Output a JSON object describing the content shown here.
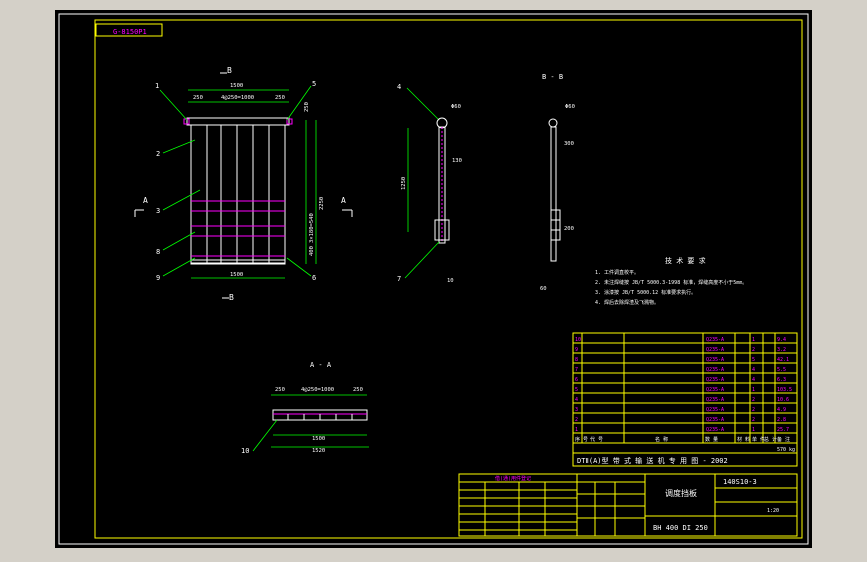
{
  "drawing_code": "G-8150P1",
  "views": {
    "front_title": "B",
    "side_title": "B - B",
    "plan_title": "A - A",
    "section_marker_a": "A",
    "section_marker_b": "B"
  },
  "dimensions": {
    "top_left": "250",
    "top_mid": "4@250=1000",
    "top_right": "250",
    "overall_top": "1500",
    "bottom_width": "1500",
    "right_top": "250",
    "right_mid": "3×180=540",
    "right_total": "2250",
    "right_low": "400",
    "side_height": "1250",
    "side_phi_1": "Φ60",
    "side_phi_2": "Φ60",
    "side_dim_130": "130",
    "side_dim_10": "10",
    "bb_dim_300": "300",
    "bb_dim_60": "60",
    "bb_dim_200": "200",
    "plan_left": "250",
    "plan_mid": "4@250=1000",
    "plan_right": "250",
    "plan_total_1": "1500",
    "plan_total_2": "1520"
  },
  "callouts": [
    "1",
    "2",
    "3",
    "8",
    "9",
    "5",
    "6",
    "4",
    "7",
    "10"
  ],
  "notes": {
    "title": "技 术 要 求",
    "lines": [
      "1. 工件调直校平。",
      "2. 未注焊缝按 JB/T 5000.3-1998 标准，焊缝高度不小于5mm。",
      "3. 涂漆按 JB/T 5000.12 标准要求执行。",
      "4. 焊后去除焊渣及飞溅物。"
    ]
  },
  "bom": {
    "rows": [
      [
        "10",
        "",
        "",
        "Q235-A",
        "",
        "1",
        "",
        "9.4"
      ],
      [
        "9",
        "",
        "",
        "Q235-A",
        "",
        "2",
        "",
        "3.2"
      ],
      [
        "8",
        "",
        "",
        "Q235-A",
        "",
        "5",
        "",
        "42.1"
      ],
      [
        "7",
        "",
        "",
        "Q235-A",
        "",
        "4",
        "",
        "5.5"
      ],
      [
        "6",
        "",
        "",
        "Q235-A",
        "",
        "4",
        "",
        "6.3"
      ],
      [
        "5",
        "",
        "",
        "Q235-A",
        "",
        "1",
        "",
        "103.5"
      ],
      [
        "4",
        "",
        "",
        "Q235-A",
        "",
        "2",
        "",
        "10.6"
      ],
      [
        "3",
        "",
        "",
        "Q235-A",
        "",
        "2",
        "",
        "4.9"
      ],
      [
        "2",
        "",
        "",
        "Q235-A",
        "",
        "2",
        "",
        "2.8"
      ],
      [
        "1",
        "",
        "",
        "Q235-A",
        "",
        "1",
        "",
        "25.7"
      ]
    ],
    "header": [
      "序 号",
      "代 号",
      "名 称",
      "数 量",
      "材 料",
      "单 件",
      "总 计",
      "备 注"
    ],
    "title_line": "DTⅡ(A)型  带 式 输 送 机 专 用 图 - 2002",
    "drawing_no": "140S10-3",
    "part_name": "调度挡板",
    "spec": "BH 400  DI 250",
    "weight": "570 kg",
    "scale": "1:20"
  },
  "revision_table": {
    "title": "借(通)用件登记",
    "rows": [
      [
        "",
        "",
        "",
        ""
      ],
      [
        "",
        "",
        "",
        ""
      ],
      [
        "",
        "",
        "",
        ""
      ],
      [
        "",
        "",
        "",
        ""
      ],
      [
        "",
        "",
        "",
        ""
      ]
    ]
  }
}
